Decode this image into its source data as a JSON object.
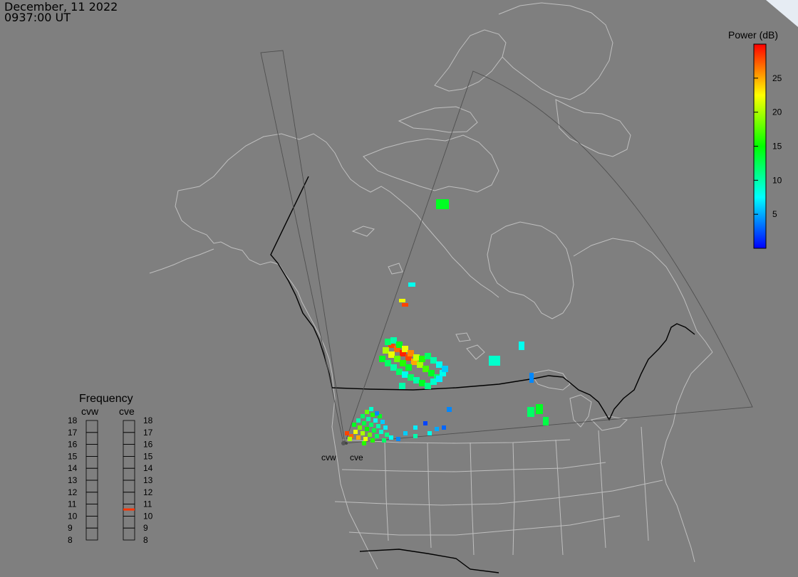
{
  "header": {
    "date": "December, 11 2022",
    "time": "0937:00 UT"
  },
  "colorbar": {
    "title": "Power (dB)",
    "ticks": [
      "25",
      "20",
      "15",
      "10",
      "5"
    ],
    "tick_values": [
      25,
      20,
      15,
      10,
      5
    ],
    "range": [
      0,
      30
    ],
    "colors": [
      "#0000ff",
      "#00ffff",
      "#00ff00",
      "#ffff00",
      "#ff0000"
    ]
  },
  "radars": [
    {
      "code": "cvw",
      "label": "cvw"
    },
    {
      "code": "cve",
      "label": "cve"
    }
  ],
  "frequency": {
    "title": "Frequency",
    "columns": [
      "cvw",
      "cve"
    ],
    "levels": [
      "18",
      "17",
      "16",
      "15",
      "14",
      "13",
      "12",
      "11",
      "10",
      "9",
      "8"
    ],
    "cvw_active": null,
    "cve_active": 11,
    "active_color": "#ff3300"
  }
}
